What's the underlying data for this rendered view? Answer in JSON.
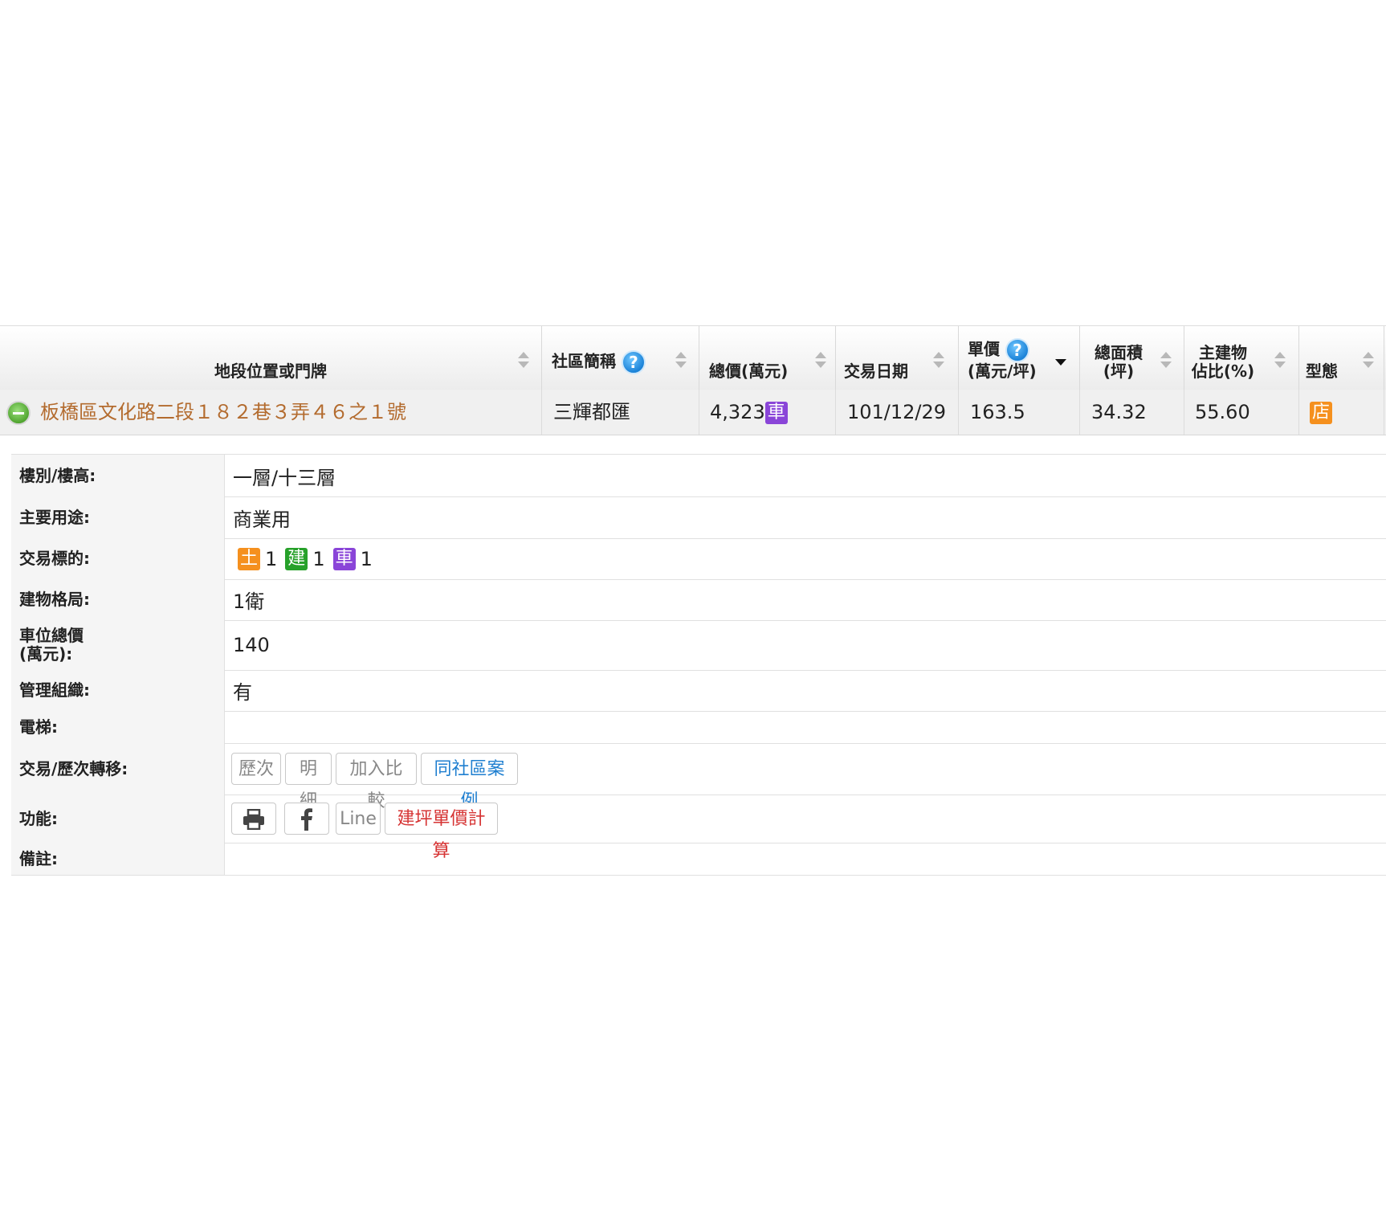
{
  "table": {
    "headers": {
      "address": "地段位置或門牌",
      "community": "社區簡稱",
      "total_price": "總價(萬元)",
      "date": "交易日期",
      "unit_price_l1": "單價",
      "unit_price_l2": "(萬元/坪)",
      "area_l1": "總面積",
      "area_l2": "(坪)",
      "main_l1": "主建物",
      "main_l2": "佔比(%)",
      "type": "型態",
      "help_glyph": "?"
    },
    "row": {
      "address": "板橋區文化路二段１８２巷３弄４６之１號",
      "community": "三輝都匯",
      "total_price": "4,323",
      "total_price_tag": "車",
      "date": "101/12/29",
      "unit_price": "163.5",
      "area": "34.32",
      "main_ratio": "55.60",
      "type_tag": "店"
    }
  },
  "details": {
    "floor_label": "樓別/樓高:",
    "floor_value": "一層/十三層",
    "usage_label": "主要用途:",
    "usage_value": "商業用",
    "target_label": "交易標的:",
    "target_items": [
      {
        "tag": "土",
        "count": "1",
        "color": "#f5901e"
      },
      {
        "tag": "建",
        "count": "1",
        "color": "#27a12a"
      },
      {
        "tag": "車",
        "count": "1",
        "color": "#8a45d8"
      }
    ],
    "layout_label": "建物格局:",
    "layout_value": "1衛",
    "parking_label_l1": "車位總價",
    "parking_label_l2": "(萬元):",
    "parking_value": "140",
    "mgmt_label": "管理組織:",
    "mgmt_value": "有",
    "elevator_label": "電梯:",
    "elevator_value": "",
    "transfer_label": "交易/歷次轉移:",
    "transfer_buttons": {
      "history": "歷次",
      "detail": "明細",
      "compare": "加入比較",
      "same_community": "同社區案例"
    },
    "function_label": "功能:",
    "function_buttons": {
      "print_icon": "print-icon",
      "facebook_icon": "facebook-icon",
      "line": "Line",
      "calc": "建坪單價計算"
    },
    "note_label": "備註:",
    "note_value": ""
  },
  "colors": {
    "address": "#b36b2e",
    "blue_link": "#1f7fd0",
    "red_link": "#d63434"
  }
}
